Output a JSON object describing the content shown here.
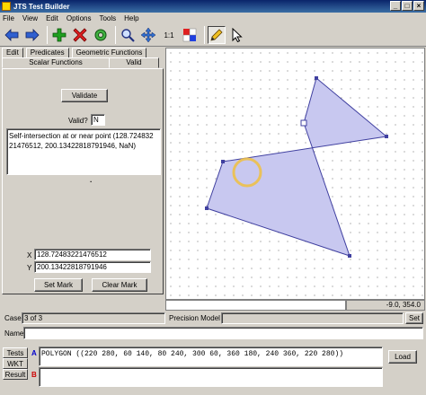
{
  "window": {
    "title": "JTS Test Builder"
  },
  "menu": [
    "File",
    "View",
    "Edit",
    "Options",
    "Tools",
    "Help"
  ],
  "toolbar": {
    "zoom_one": "1:1",
    "tools": [
      "back-arrow-icon",
      "forward-arrow-icon",
      "add-icon",
      "delete-icon",
      "gear-icon",
      "zoom-icon",
      "pan-icon",
      "color-icon",
      "pencil-icon",
      "pointer-icon"
    ]
  },
  "tabs_top": [
    "Edit",
    "Predicates",
    "Geometric Functions"
  ],
  "tabs_second": [
    "Scalar Functions",
    "Valid"
  ],
  "valid_panel": {
    "validate_label": "Validate",
    "valid_label": "Valid?",
    "valid_value": "N",
    "message_line1": "Self-intersection at or near point (128.724832",
    "message_line2": "21476512, 200.13422818791946, NaN)",
    "x_label": "X",
    "x_value": "128.72483221476512",
    "y_label": "Y",
    "y_value": "200.13422818791946",
    "set_mark_label": "Set Mark",
    "clear_mark_label": "Clear Mark"
  },
  "status": {
    "coord_readout": "-9.0, 354.0",
    "case_label": "Case",
    "case_value": "3 of 3",
    "precision_label": "Precision Model",
    "set_label": "Set",
    "name_label": "Name"
  },
  "bottom": {
    "tests_label": "Tests",
    "wkt_label": "WKT",
    "result_label": "Result",
    "geom_a_label": "A",
    "geom_b_label": "B",
    "geom_a_wkt": "POLYGON ((220 280, 60 140, 80 240, 300 60, 360 180, 240 360, 220 280))",
    "load_label": "Load"
  },
  "colors": {
    "accent_blue": "#0a246a",
    "polygon_fill": "#c8c8f0",
    "polygon_stroke": "#4040a0",
    "mark_ring": "#f0c040",
    "geom_a": "#0000cc",
    "geom_b": "#cc0000"
  }
}
